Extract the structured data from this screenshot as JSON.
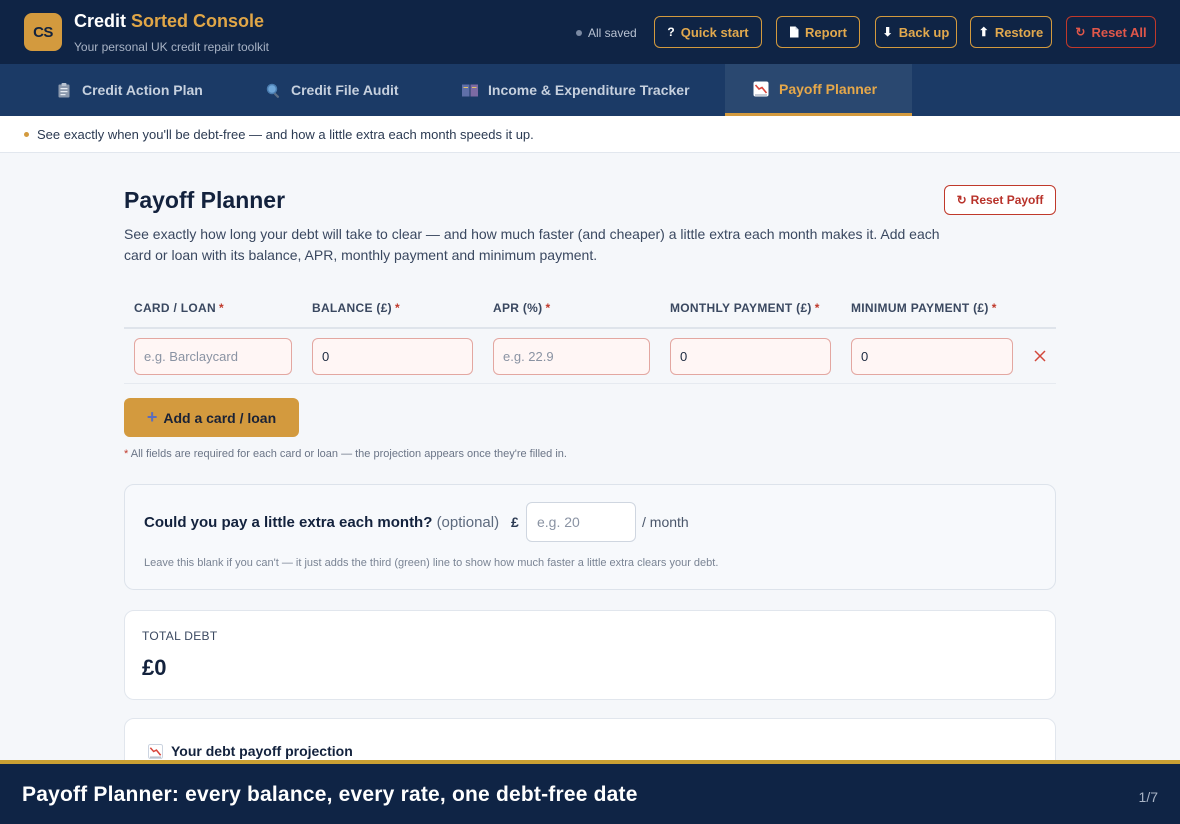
{
  "header": {
    "logo_text": "CS",
    "brand_a": "Credit",
    "brand_b": "Sorted Console",
    "tagline": "Your personal UK credit repair toolkit",
    "saved_status": "All saved",
    "buttons": {
      "quick_start": "Quick start",
      "report": "Report",
      "backup": "Back up",
      "restore": "Restore",
      "reset_all": "Reset All"
    }
  },
  "tabs": [
    {
      "label": "Credit Action Plan",
      "icon": "clipboard-icon"
    },
    {
      "label": "Credit File Audit",
      "icon": "magnifier-icon"
    },
    {
      "label": "Income & Expenditure Tracker",
      "icon": "ledger-icon"
    },
    {
      "label": "Payoff Planner",
      "icon": "chart-down-icon"
    }
  ],
  "active_tab": "Payoff Planner",
  "info_strip": "See exactly when you'll be debt-free — and how a little extra each month speeds it up.",
  "main": {
    "title": "Payoff Planner",
    "reset_payoff": "Reset Payoff",
    "description": "See exactly how long your debt will take to clear — and how much faster (and cheaper) a little extra each month makes it. Add each card or loan with its balance, APR, monthly payment and minimum payment.",
    "table": {
      "columns": [
        "CARD / LOAN",
        "BALANCE (£)",
        "APR (%)",
        "MONTHLY PAYMENT (£)",
        "MINIMUM PAYMENT (£)"
      ],
      "required_mark": "*",
      "rows": [
        {
          "card_placeholder": "e.g. Barclaycard",
          "balance_value": "0",
          "apr_placeholder": "e.g. 22.9",
          "monthly_value": "0",
          "minimum_value": "0"
        }
      ]
    },
    "add_button": "Add a card / loan",
    "required_note": "All fields are required for each card or loan — the projection appears once they're filled in.",
    "extra": {
      "question": "Could you pay a little extra each month?",
      "optional": "(optional)",
      "currency": "£",
      "placeholder": "e.g. 20",
      "suffix": "/ month",
      "note": "Leave this blank if you can't — it just adds the third (green) line to show how much faster a little extra clears your debt."
    },
    "total": {
      "label": "TOTAL DEBT",
      "value": "£0"
    },
    "projection_title": "Your debt payoff projection"
  },
  "caption": {
    "text": "Payoff Planner: every balance, every rate, one debt-free date",
    "page": "1/7"
  },
  "colors": {
    "navy": "#0f2445",
    "tab_bar": "#1b3a66",
    "gold": "#d39a3e",
    "danger": "#c0392b"
  }
}
